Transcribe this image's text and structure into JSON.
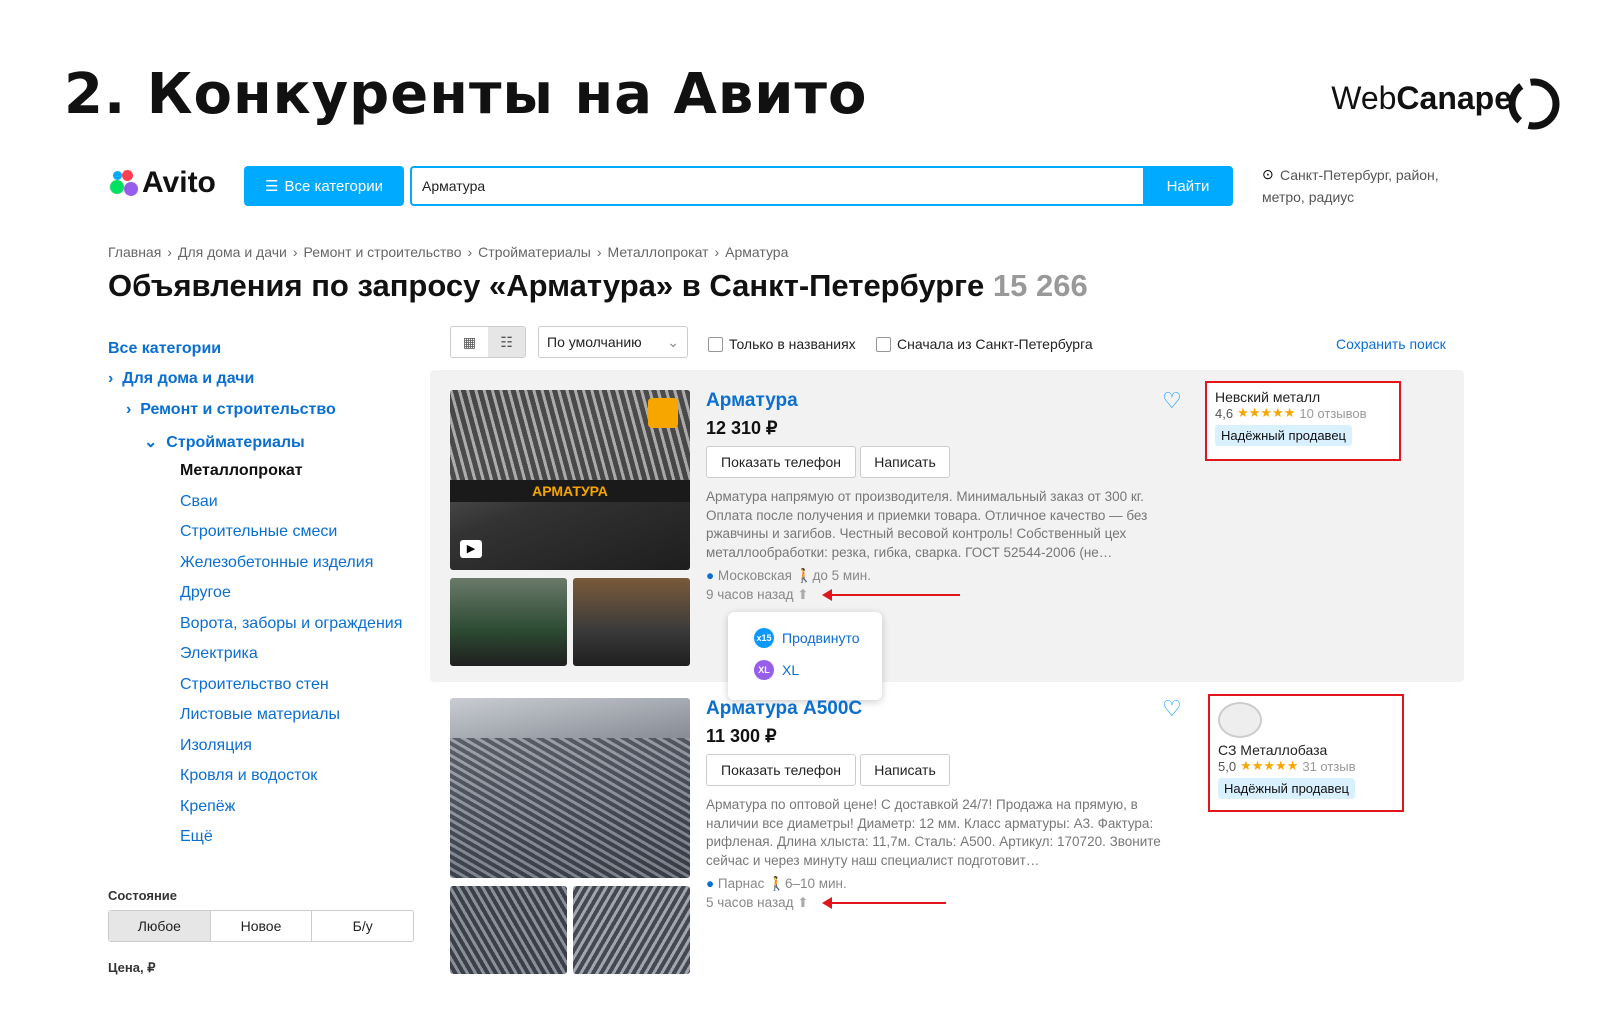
{
  "slide": {
    "title": "2. Конкуренты на Авито",
    "brand_web": "Web",
    "brand_canape": "Canape"
  },
  "header": {
    "logo": "Avito",
    "categories_button": "Все категории",
    "search_value": "Арматура",
    "find_button": "Найти",
    "location": "Санкт-Петербург, район, метро, радиус"
  },
  "breadcrumb": [
    "Главная",
    "Для дома и дачи",
    "Ремонт и строительство",
    "Стройматериалы",
    "Металлопрокат",
    "Арматура"
  ],
  "page": {
    "heading": "Объявления по запросу «Арматура» в Санкт-Петербурге",
    "count": "15 266"
  },
  "sidebar": {
    "all_categories": "Все категории",
    "level1": "Для дома и дачи",
    "level2": "Ремонт и строительство",
    "level3": "Стройматериалы",
    "active": "Металлопрокат",
    "items": [
      "Сваи",
      "Строительные смеси",
      "Железобетонные изделия",
      "Другое",
      "Ворота, заборы и ограждения",
      "Электрика",
      "Строительство стен",
      "Листовые материалы",
      "Изоляция",
      "Кровля и водосток",
      "Крепёж",
      "Ещё"
    ],
    "state_label": "Состояние",
    "state_options": [
      "Любое",
      "Новое",
      "Б/у"
    ],
    "price_label": "Цена, ₽"
  },
  "toolbar": {
    "sort": "По умолчанию",
    "only_titles": "Только в названиях",
    "first_from_spb": "Сначала из Санкт-Петербурга",
    "save_search": "Сохранить поиск"
  },
  "listings": [
    {
      "title": "Арматура",
      "price": "12 310 ₽",
      "show_phone": "Показать телефон",
      "write": "Написать",
      "description": "Арматура напрямую от производителя. Минимальный заказ от 300 кг. Оплата после получения и приемки товара. Отличное качество — без ржавчины и загибов. Честный весовой контроль! Собственный цех металлообработки: резка, гибка, сварка. ГОСТ 52544-2006 (не…",
      "metro": "Московская",
      "walk": "до 5 мин.",
      "time": "9 часов назад",
      "image_text": "АРМАТУРА",
      "seller": {
        "name": "Невский металл",
        "rating": "4,6",
        "stars": "★★★★★",
        "reviews": "10 отзывов",
        "badge": "Надёжный продавец"
      }
    },
    {
      "title": "Арматура А500С",
      "price": "11 300 ₽",
      "show_phone": "Показать телефон",
      "write": "Написать",
      "description": "Арматура по оптовой цене! С доставкой 24/7! Продажа на прямую, в наличии все диаметры! Диаметр: 12 мм. Класс арматуры: А3. Фактура: рифленая. Длина хлыста: 11,7м. Сталь: А500. Артикул: 170720. Звоните сейчас и через минуту наш специалист подготовит…",
      "metro": "Парнас",
      "walk": "6–10 мин.",
      "time": "5 часов назад",
      "seller": {
        "name": "СЗ Металлобаза",
        "rating": "5,0",
        "stars": "★★★★★",
        "reviews": "31 отзыв",
        "badge": "Надёжный продавец"
      }
    }
  ],
  "promo": {
    "promoted": "Продвинуто",
    "xl": "XL"
  },
  "colors": {
    "avito_blue": "#00aaff",
    "link_blue": "#0a6fcf",
    "highlight_red": "#e0161c",
    "star_orange": "#f7a600"
  }
}
